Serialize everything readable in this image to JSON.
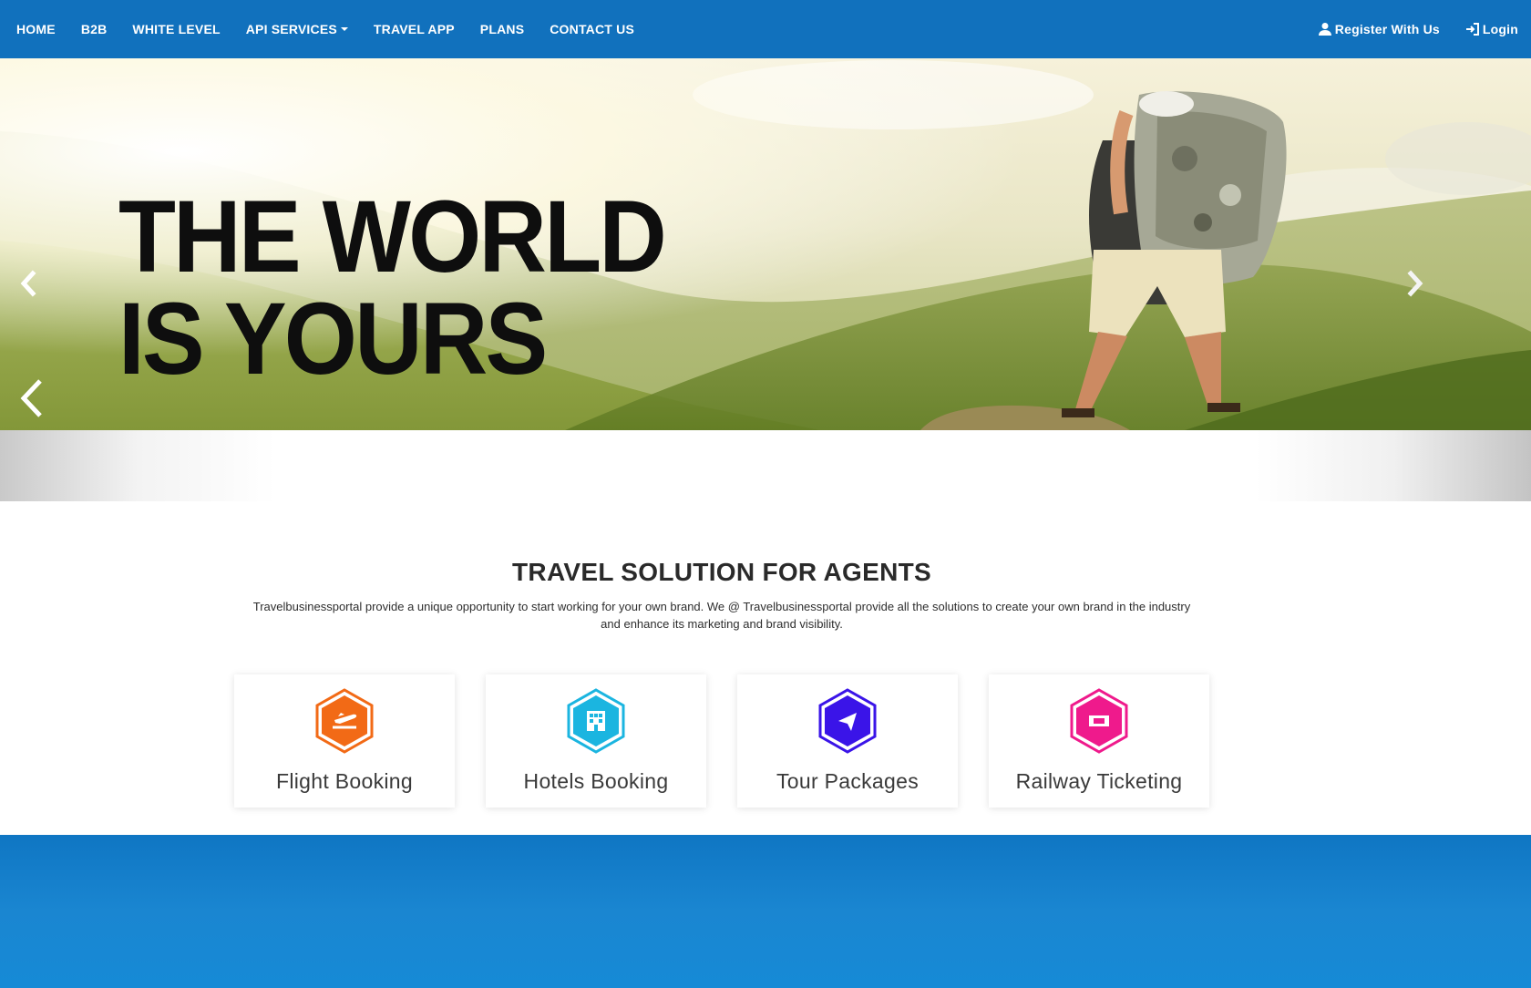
{
  "colors": {
    "nav_bg": "#1171bd",
    "footer_bg": "#1a86d1",
    "flight": "#f26a16",
    "hotels": "#1bb5e0",
    "tour": "#3a14e8",
    "railway": "#ef1a8c"
  },
  "nav": {
    "left": [
      {
        "label": "HOME"
      },
      {
        "label": "B2B"
      },
      {
        "label": "WHITE LEVEL"
      },
      {
        "label": "API SERVICES"
      },
      {
        "label": "TRAVEL APP"
      },
      {
        "label": "PLANS"
      },
      {
        "label": "CONTACT US"
      }
    ],
    "register_label": "Register With Us",
    "register_icon": "user-icon",
    "login_label": "Login",
    "login_icon": "sign-in-icon"
  },
  "hero": {
    "line1": "THE WORLD",
    "line2": "IS YOURS",
    "prev_icon": "chevron-left-icon",
    "next_icon": "chevron-right-icon"
  },
  "solutions": {
    "title": "TRAVEL SOLUTION FOR AGENTS",
    "description": "Travelbusinessportal provide a unique opportunity to start working for your own brand. We @ Travelbusinessportal provide all the solutions to create your own brand in the industry and enhance its marketing and brand visibility.",
    "cards": [
      {
        "label": "Flight Booking",
        "icon": "plane-departure-icon"
      },
      {
        "label": "Hotels Booking",
        "icon": "building-icon"
      },
      {
        "label": "Tour Packages",
        "icon": "paper-plane-icon"
      },
      {
        "label": "Railway Ticketing",
        "icon": "ticket-icon"
      }
    ]
  }
}
